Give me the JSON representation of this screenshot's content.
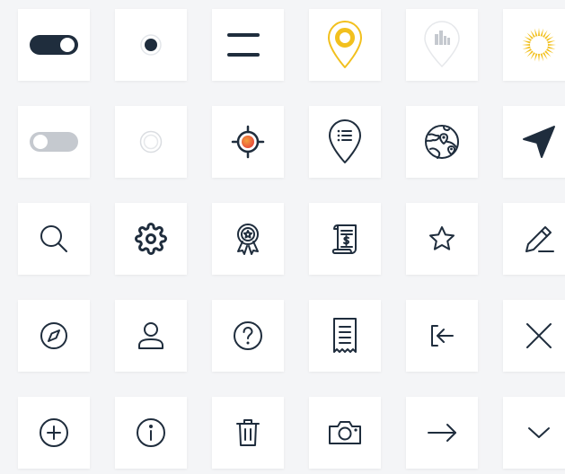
{
  "colors": {
    "ink": "#1f2d3d",
    "muted": "#c5c9cf",
    "accent_yellow": "#f2c01e",
    "accent_orange": "#f08a24",
    "accent_red": "#e8423b",
    "tile_background": "#ffffff",
    "page_background": "#f4f5f7"
  },
  "icons": [
    [
      "toggle-on-icon",
      "radio-selected-icon",
      "menu-gradient-icon",
      "location-pin-yellow-icon",
      "location-pin-city-icon",
      "sun-yellow-icon"
    ],
    [
      "toggle-off-icon",
      "radio-unselected-icon",
      "crosshair-target-icon",
      "location-pin-list-icon",
      "globe-map-icon",
      "navigation-arrow-icon"
    ],
    [
      "search-icon",
      "gear-icon",
      "award-badge-icon",
      "receipt-scroll-icon",
      "star-icon",
      "pencil-icon"
    ],
    [
      "compass-icon",
      "user-icon",
      "help-circle-icon",
      "receipt-icon",
      "sign-in-icon",
      "close-icon"
    ],
    [
      "plus-circle-icon",
      "info-circle-icon",
      "trash-icon",
      "camera-icon",
      "arrow-right-icon",
      "chevron-down-icon"
    ]
  ]
}
